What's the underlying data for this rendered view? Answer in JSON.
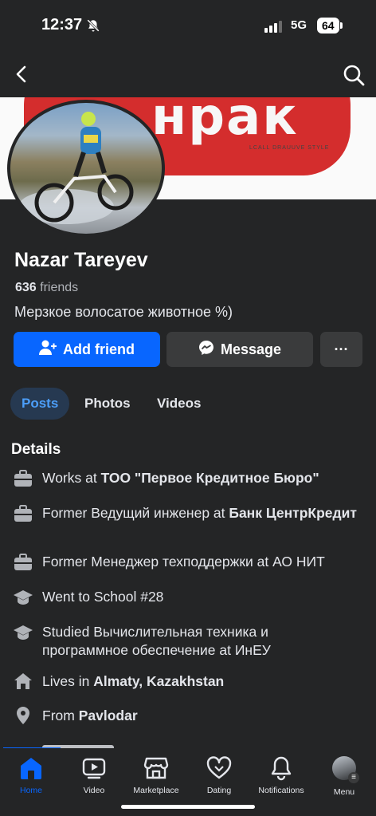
{
  "status_bar": {
    "time": "12:37",
    "network": "5G",
    "battery": "64"
  },
  "cover": {
    "text": "нрак",
    "caption": "LCALL DRAUUVE STYLE"
  },
  "profile": {
    "name": "Nazar Tareyev",
    "friends_count": "636",
    "friends_label": "friends",
    "bio": "Мерзкое волосатое животное %)"
  },
  "actions": {
    "add_friend": "Add friend",
    "message": "Message",
    "more": "···"
  },
  "tabs": [
    {
      "label": "Posts",
      "active": true
    },
    {
      "label": "Photos",
      "active": false
    },
    {
      "label": "Videos",
      "active": false
    }
  ],
  "details": {
    "heading": "Details",
    "items": [
      {
        "icon": "briefcase-icon",
        "prefix": "Works at ",
        "bold": "ТОО \"Первое Кредитное Бюро\""
      },
      {
        "icon": "briefcase-icon",
        "prefix": "Former Ведущий инженер at ",
        "bold": "Банк ЦентрКредит"
      },
      {
        "icon": "briefcase-icon",
        "prefix": "Former Менеджер техподдержки at АО НИТ",
        "bold": ""
      },
      {
        "icon": "graduation-cap-icon",
        "prefix": "Went to School #28",
        "bold": ""
      },
      {
        "icon": "graduation-cap-icon",
        "prefix": "Studied Вычислительная техника и программное обеспечение at ИнЕУ",
        "bold": ""
      },
      {
        "icon": "home-icon",
        "prefix": "Lives in ",
        "bold": "Almaty, Kazakhstan"
      },
      {
        "icon": "location-pin-icon",
        "prefix": "From ",
        "bold": "Pavlodar"
      }
    ]
  },
  "bottom_nav": [
    {
      "label": "Home",
      "icon": "home-icon",
      "active": true
    },
    {
      "label": "Video",
      "icon": "video-icon",
      "active": false
    },
    {
      "label": "Marketplace",
      "icon": "marketplace-icon",
      "active": false
    },
    {
      "label": "Dating",
      "icon": "dating-icon",
      "active": false
    },
    {
      "label": "Notifications",
      "icon": "bell-icon",
      "active": false
    },
    {
      "label": "Menu",
      "icon": "profile-avatar",
      "active": false
    }
  ],
  "colors": {
    "accent": "#0866ff",
    "background": "#242526",
    "button_secondary": "#3a3b3c",
    "active_tab_bg": "#263951",
    "active_tab_text": "#4c9ef9"
  }
}
